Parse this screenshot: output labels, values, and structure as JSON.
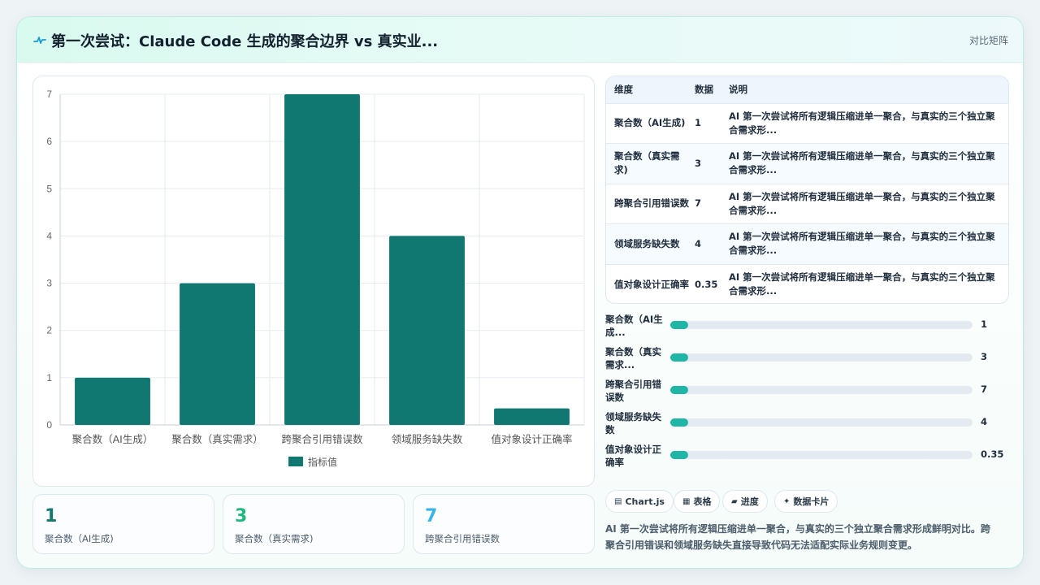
{
  "header": {
    "title": "第一次尝试：Claude Code 生成的聚合边界 vs 真实业...",
    "tag": "对比矩阵",
    "icon": "pulse-line-icon"
  },
  "chart_data": {
    "type": "bar",
    "categories": [
      "聚合数（AI生成）",
      "聚合数（真实需求）",
      "跨聚合引用错误数",
      "领域服务缺失数",
      "值对象设计正确率"
    ],
    "series": [
      {
        "name": "指标值",
        "values": [
          1,
          3,
          7,
          4,
          0.35
        ]
      }
    ],
    "ylim": [
      0,
      7
    ],
    "yticks": [
      0,
      1,
      2,
      3,
      4,
      5,
      6,
      7
    ],
    "grid": true,
    "legend": "bottom",
    "color": "#117771"
  },
  "stats": [
    {
      "value": "1",
      "label": "聚合数（AI生成)",
      "color": "#147a6e"
    },
    {
      "value": "3",
      "label": "聚合数（真实需求)",
      "color": "#20b880"
    },
    {
      "value": "7",
      "label": "跨聚合引用错误数",
      "color": "#38b4e6"
    }
  ],
  "table": {
    "headers": [
      "维度",
      "数据",
      "说明"
    ],
    "rows": [
      {
        "dim": "聚合数（AI生成)",
        "val": "1",
        "desc": "AI 第一次尝试将所有逻辑压缩进单一聚合，与真实的三个独立聚合需求形..."
      },
      {
        "dim": "聚合数（真实需求)",
        "val": "3",
        "desc": "AI 第一次尝试将所有逻辑压缩进单一聚合，与真实的三个独立聚合需求形..."
      },
      {
        "dim": "跨聚合引用错误数",
        "val": "7",
        "desc": "AI 第一次尝试将所有逻辑压缩进单一聚合，与真实的三个独立聚合需求形..."
      },
      {
        "dim": "领域服务缺失数",
        "val": "4",
        "desc": "AI 第一次尝试将所有逻辑压缩进单一聚合，与真实的三个独立聚合需求形..."
      },
      {
        "dim": "值对象设计正确率",
        "val": "0.35",
        "desc": "AI 第一次尝试将所有逻辑压缩进单一聚合，与真实的三个独立聚合需求形..."
      }
    ]
  },
  "progress": [
    {
      "label": "聚合数（AI生成...",
      "value": "1",
      "fraction": 0.06
    },
    {
      "label": "聚合数（真实需求...",
      "value": "3",
      "fraction": 0.06
    },
    {
      "label": "跨聚合引用错误数",
      "value": "7",
      "fraction": 0.06
    },
    {
      "label": "领域服务缺失数",
      "value": "4",
      "fraction": 0.06
    },
    {
      "label": "值对象设计正确率",
      "value": "0.35",
      "fraction": 0.06
    }
  ],
  "chips": [
    {
      "label": "Chart.js",
      "icon": "chart-icon"
    },
    {
      "label": "表格",
      "icon": "table-icon"
    },
    {
      "label": "进度",
      "icon": "progress-icon"
    },
    {
      "label": "数据卡片",
      "icon": "sparkle-icon"
    }
  ],
  "summary": "AI 第一次尝试将所有逻辑压缩进单一聚合，与真实的三个独立聚合需求形成鲜明对比。跨聚合引用错误和领域服务缺失直接导致代码无法适配实际业务规则变更。"
}
